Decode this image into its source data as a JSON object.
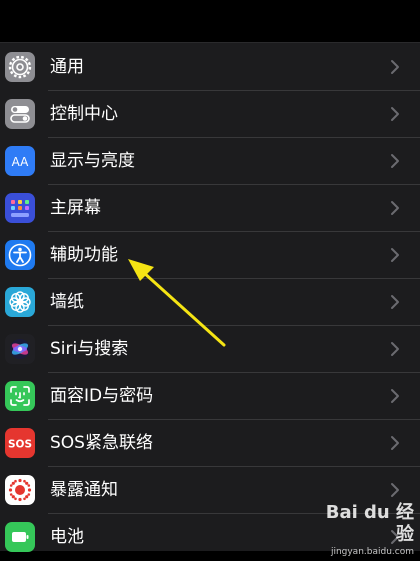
{
  "settings": {
    "items": [
      {
        "label": "通用",
        "icon": "gear-icon",
        "color": "#8e8e93"
      },
      {
        "label": "控制中心",
        "icon": "toggles-icon",
        "color": "#8e8e93"
      },
      {
        "label": "显示与亮度",
        "icon": "text-size-icon",
        "color": "#2f7cf6"
      },
      {
        "label": "主屏幕",
        "icon": "home-screen-grid-icon",
        "color": "#3a4fd8"
      },
      {
        "label": "辅助功能",
        "icon": "accessibility-icon",
        "color": "#1f7af0"
      },
      {
        "label": "墙纸",
        "icon": "flower-icon",
        "color": "#2aa8d8"
      },
      {
        "label": "Siri与搜索",
        "icon": "siri-icon",
        "color": "#202024"
      },
      {
        "label": "面容ID与密码",
        "icon": "face-id-icon",
        "color": "#35c759"
      },
      {
        "label": "SOS紧急联络",
        "icon": "sos-icon",
        "color": "#e5362f"
      },
      {
        "label": "暴露通知",
        "icon": "exposure-notification-icon",
        "color": "#ffffff"
      },
      {
        "label": "电池",
        "icon": "battery-icon",
        "color": "#35c759"
      }
    ]
  },
  "annotation": {
    "arrow_color": "#f5e414"
  },
  "watermark": {
    "logo": "Bai du 经验",
    "url": "jingyan.baidu.com"
  }
}
